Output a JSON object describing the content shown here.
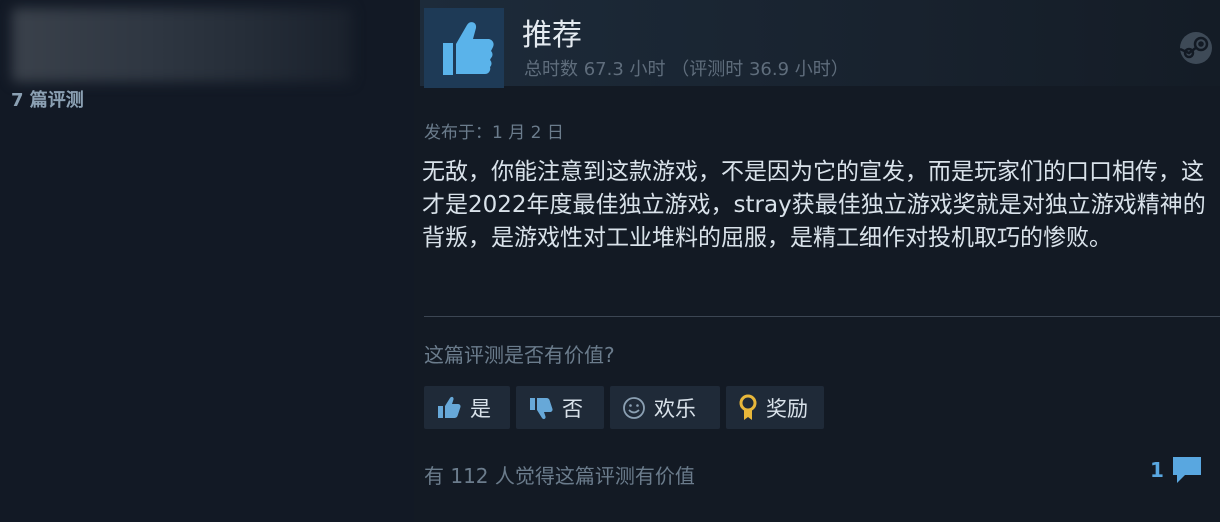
{
  "reviewer": {
    "review_count": "7 篇评测"
  },
  "review": {
    "recommendation": "推荐",
    "hours": "总时数 67.3 小时 （评测时 36.9 小时）",
    "posted": "发布于：1 月 2 日",
    "body": "无敌，你能注意到这款游戏，不是因为它的宣发，而是玩家们的口口相传，这才是2022年度最佳独立游戏，stray获最佳独立游戏奖就是对独立游戏精神的背叛，是游戏性对工业堆料的屈服，是精工细作对投机取巧的惨败。"
  },
  "helpful": {
    "question": "这篇评测是否有价值?",
    "yes_label": "是",
    "no_label": "否",
    "funny_label": "欢乐",
    "award_label": "奖励",
    "found_helpful": "有 112 人觉得这篇评测有价值",
    "comment_count": "1"
  },
  "icons": {
    "recommend": "thumbs-up-icon",
    "steam": "steam-logo-icon",
    "yes": "thumbs-up-icon",
    "no": "thumbs-down-icon",
    "funny": "smiley-icon",
    "award": "award-icon",
    "comment": "comment-icon"
  },
  "colors": {
    "background": "#131a24",
    "accent_blue": "#59a7e0",
    "award_gold": "#e8b73a"
  }
}
